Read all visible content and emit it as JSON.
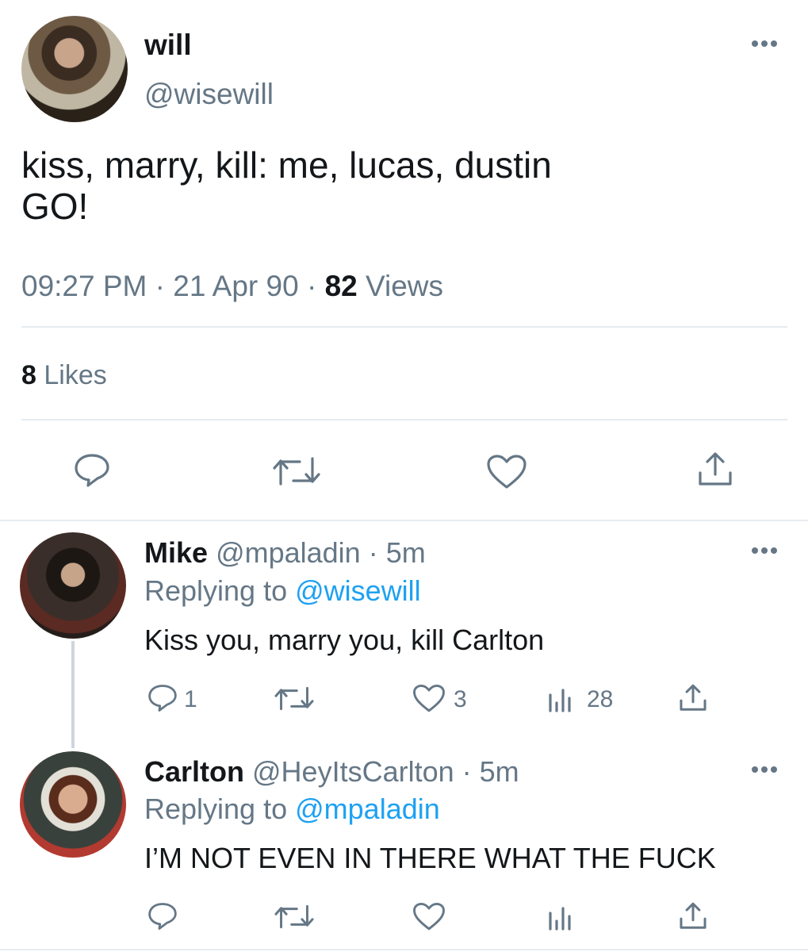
{
  "main_tweet": {
    "name": "will",
    "handle": "@wisewill",
    "text_line1": "kiss, marry, kill: me, lucas, dustin",
    "text_line2": "GO!",
    "time": "09:27 PM",
    "sep": "·",
    "date": "21 Apr 90",
    "views_count": "82",
    "views_label": "Views",
    "likes_count": "8",
    "likes_label": "Likes"
  },
  "replies": [
    {
      "name": "Mike",
      "handle": "@mpaladin",
      "age": "· 5m",
      "replying_prefix": "Replying to",
      "replying_to": "@wisewill",
      "text": "Kiss you, marry you, kill Carlton",
      "reply_count": "1",
      "like_count": "3",
      "view_count": "28"
    },
    {
      "name": "Carlton",
      "handle": "@HeyItsCarlton",
      "age": "· 5m",
      "replying_prefix": "Replying to",
      "replying_to": "@mpaladin",
      "text": "I’M NOT EVEN IN THERE WHAT THE FUCK"
    }
  ],
  "icons": [
    "more-icon",
    "reply-icon",
    "retweet-icon",
    "like-icon",
    "share-icon",
    "views-icon"
  ],
  "colors": {
    "text": "#14171a",
    "muted": "#657786",
    "link": "#1da1f2",
    "divider": "#e6ecf0"
  }
}
